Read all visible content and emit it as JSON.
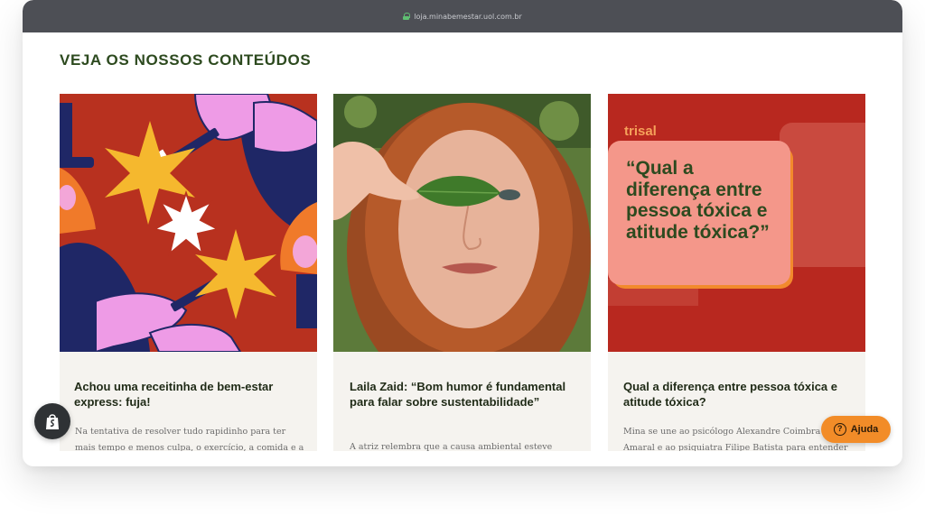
{
  "browser": {
    "url": "loja.minabemestar.uol.com.br"
  },
  "section": {
    "title": "VEJA OS NOSSOS CONTEÚDOS"
  },
  "cards": [
    {
      "title": "Achou uma receitinha de bem-estar express: fuja!",
      "excerpt": "Na tentativa de resolver tudo rapidinho para ter mais tempo e menos culpa, o exercício, a comida e a",
      "image": "illustration-hands-wands-stars"
    },
    {
      "title": " Laila Zaid: “Bom humor é fundamental para falar sobre sustentabilidade”",
      "excerpt": "A atriz relembra que a causa ambiental esteve",
      "image": "photo-woman-leaf-over-eye"
    },
    {
      "title": " Qual a diferença entre pessoa tóxica e atitude tóxica?",
      "excerpt": "Mina se une ao psicólogo Alexandre Coimbra Amaral e ao psiquiatra Filipe Batista para entender o",
      "image": "quote-card",
      "brand": "trisal",
      "quote": "“Qual a diferença entre pessoa tóxica e atitude tóxica?”"
    }
  ],
  "widgets": {
    "shopify_icon": "shopify-bag-icon",
    "help_label": "Ajuda",
    "help_icon": "question-circle-icon"
  },
  "colors": {
    "heading": "#2d4a1f",
    "help_button": "#f28c28",
    "quote_bg": "#b8281f",
    "quote_box": "#f4978a"
  }
}
